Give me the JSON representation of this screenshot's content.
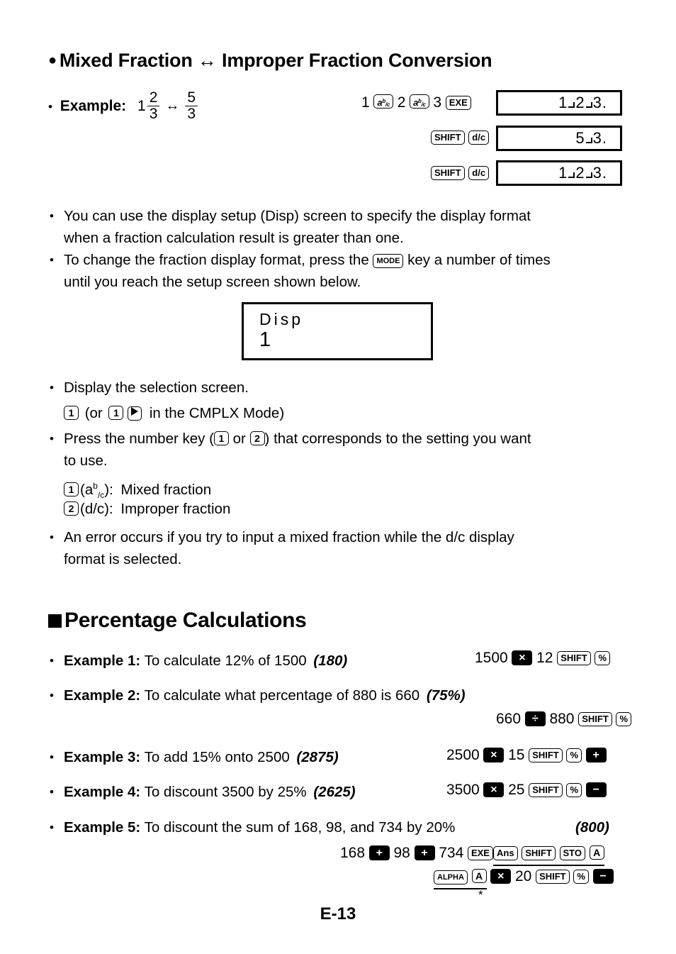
{
  "page": {
    "footer": "E-13"
  },
  "section1": {
    "bullet": "●",
    "title": "Mixed Fraction ↔ Improper Fraction Conversion",
    "example_label": "Example:",
    "example_bullet": "•",
    "fraction_expression": {
      "whole": "1",
      "numerator": "2",
      "denominator": "3",
      "arrow": "↔",
      "improper_numerator": "5",
      "improper_denominator": "3"
    },
    "key_rows": [
      {
        "tokens": [
          "1",
          "a b/c",
          "2",
          "a b/c",
          "3",
          "EXE"
        ],
        "display": "1 2 3."
      },
      {
        "tokens": [
          "SHIFT",
          "d/c"
        ],
        "display": "5 3."
      },
      {
        "tokens": [
          "SHIFT",
          "d/c"
        ],
        "display": "1 2 3."
      }
    ],
    "notes": [
      {
        "bullet": "•",
        "line1": "You can use the display setup (Disp) screen to specify the display format",
        "line2": "when a fraction calculation result is greater than one."
      },
      {
        "bullet": "•",
        "line1_before": "To change the fraction display format, press the ",
        "line1_key": "MODE",
        "line1_after": " key a number of times",
        "line2": "until you reach the setup screen shown below."
      }
    ],
    "setup_screen": {
      "label": "Disp",
      "value": "1"
    },
    "selection": {
      "bullet": "•",
      "text": "Display the selection screen.",
      "keyline_key1": "1",
      "keyline_mid": "(or",
      "keyline_key2": "1",
      "keyline_key3": "right-arrow",
      "keyline_tail": "in the CMPLX Mode)"
    },
    "press_note": {
      "bullet": "•",
      "before": "Press the number key (",
      "key1": "1",
      "middle": " or ",
      "key2": "2",
      "after": ") that corresponds to the setting you want",
      "line2": "to use."
    },
    "format_options": [
      {
        "key": "1",
        "paren": "(a b/c):",
        "label": "Mixed fraction"
      },
      {
        "key": "2",
        "paren": "(d/c):",
        "label": "Improper fraction"
      }
    ],
    "error_note": {
      "bullet": "•",
      "line1": "An error occurs if you try to input a mixed fraction while the d/c display",
      "line2": "format is selected."
    }
  },
  "section2": {
    "title": "Percentage Calculations",
    "examples": [
      {
        "bullet": "•",
        "label": "Example 1:",
        "text": "To calculate 12% of 1500",
        "answer": "(180)",
        "keys": [
          "1500",
          "×",
          "12",
          "SHIFT",
          "%"
        ]
      },
      {
        "bullet": "•",
        "label": "Example 2:",
        "text": "To calculate what percentage of 880 is 660",
        "answer": "(75%)",
        "keys": [
          "660",
          "÷",
          "880",
          "SHIFT",
          "%"
        ]
      },
      {
        "bullet": "•",
        "label": "Example 3:",
        "text": "To add 15% onto 2500",
        "answer": "(2875)",
        "keys": [
          "2500",
          "×",
          "15",
          "SHIFT",
          "%",
          "+"
        ]
      },
      {
        "bullet": "•",
        "label": "Example 4:",
        "text": "To discount 3500 by 25%",
        "answer": "(2625)",
        "keys": [
          "3500",
          "×",
          "25",
          "SHIFT",
          "%",
          "−"
        ]
      },
      {
        "bullet": "•",
        "label": "Example 5:",
        "text": "To discount the sum of 168, 98, and 734 by 20%",
        "answer": "(800)",
        "keys_line1": [
          "168",
          "+",
          "98",
          "+",
          "734",
          "EXE",
          "Ans",
          "SHIFT",
          "STO",
          "A"
        ],
        "keys_line2": [
          "ALPHA",
          "A",
          "×",
          "20",
          "SHIFT",
          "%",
          "−"
        ],
        "footnote_marker": "*"
      }
    ]
  },
  "key_glyphs": {
    "exe": "EXE",
    "shift": "SHIFT",
    "dc": "d/c",
    "mode": "MODE",
    "ans": "Ans",
    "sto": "STO",
    "alpha": "ALPHA",
    "a_var": "A",
    "percent": "%",
    "one": "1",
    "two": "2",
    "plus": "+",
    "minus": "−",
    "times": "×",
    "divide": "÷"
  },
  "colors": {
    "ink": "#000000",
    "paper": "#ffffff"
  }
}
